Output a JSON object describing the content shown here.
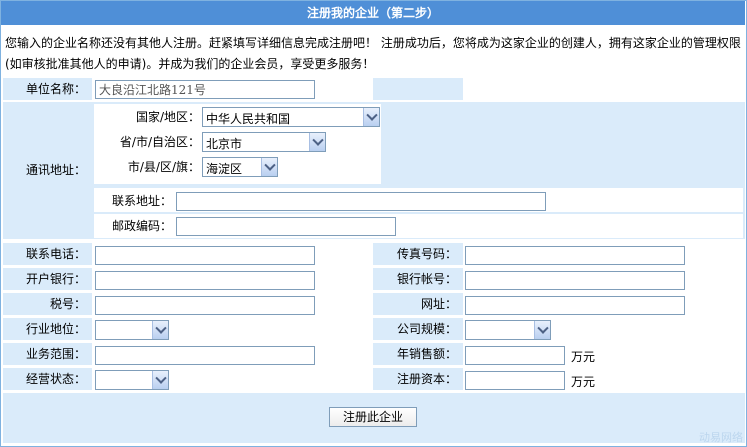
{
  "title": "注册我的企业（第二步）",
  "intro": "您输入的企业名称还没有其他人注册。赶紧填写详细信息完成注册吧！ 注册成功后，您将成为这家企业的创建人，拥有这家企业的管理权限(如审核批准其他人的申请)。并成为我们的企业会员，享受更多服务！",
  "form": {
    "company_name_label": "单位名称：",
    "company_name_value": "大良沿江北路121号",
    "address_label": "通讯地址：",
    "country_label": "国家/地区：",
    "country_value": "中华人民共和国",
    "province_label": "省/市/自治区：",
    "province_value": "北京市",
    "city_label": "市/县/区/旗：",
    "city_value": "海淀区",
    "contact_address_label": "联系地址：",
    "zip_label": "邮政编码：",
    "phone_label": "联系电话：",
    "fax_label": "传真号码：",
    "bank_label": "开户银行：",
    "account_label": "银行帐号：",
    "tax_label": "税号：",
    "website_label": "网址：",
    "industry_label": "行业地位：",
    "size_label": "公司规模：",
    "business_label": "业务范围：",
    "sales_label": "年销售额：",
    "sales_unit": "万元",
    "status_label": "经营状态：",
    "capital_label": "注册资本：",
    "capital_unit": "万元"
  },
  "submit_label": "注册此企业",
  "watermark": "动易网络"
}
